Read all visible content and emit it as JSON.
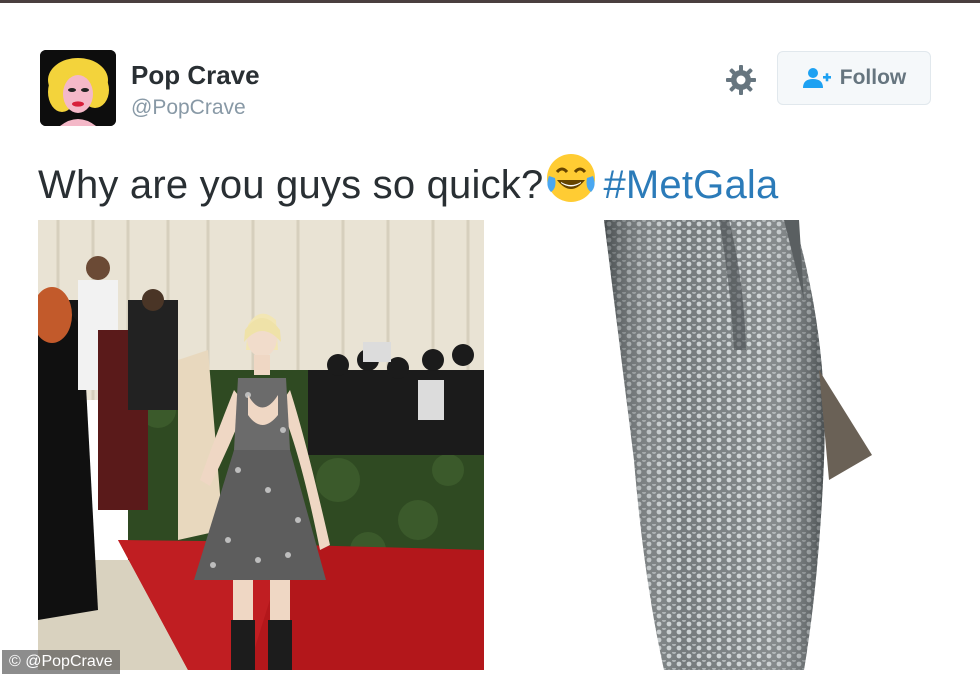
{
  "tweet": {
    "author_name": "Pop Crave",
    "author_handle": "@PopCrave",
    "text_before": "Why are you guys so quick?",
    "emoji": "face-with-tears-of-joy",
    "hashtag": "#MetGala",
    "follow_label": "Follow"
  },
  "icons": {
    "settings": "gear-icon",
    "follow": "add-user-icon"
  },
  "colors": {
    "name": "#292f33",
    "handle": "#8899a6",
    "hashtag": "#2b7bb9",
    "follow_text": "#66757f",
    "follow_bg": "#f5f8fa",
    "follow_icon": "#1da1f2"
  },
  "watermark": "© @PopCrave"
}
